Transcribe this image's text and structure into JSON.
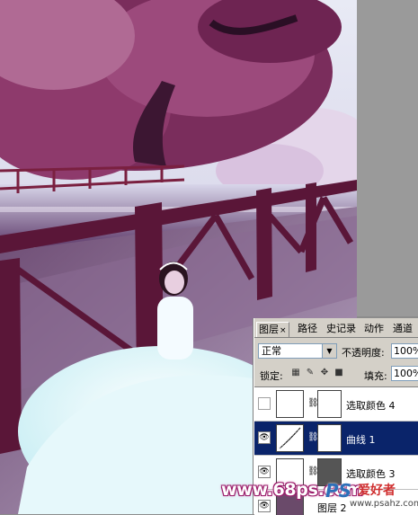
{
  "layers_panel": {
    "tabs": [
      {
        "label": "图层",
        "active": true,
        "close": "×"
      },
      {
        "label": "路径"
      },
      {
        "label": "史记录"
      },
      {
        "label": "动作"
      },
      {
        "label": "通道"
      }
    ],
    "blend_mode": "正常",
    "opacity_label": "不透明度:",
    "opacity_value": "100%",
    "lock_label": "锁定:",
    "fill_label": "填充:",
    "fill_value": "100%",
    "layers": [
      {
        "name": "选取颜色 4",
        "visible": false,
        "selected": false
      },
      {
        "name": "曲线 1",
        "visible": true,
        "selected": true
      },
      {
        "name": "选取颜色 3",
        "visible": true,
        "selected": false
      },
      {
        "name": "图层 2",
        "visible": true,
        "selected": false
      }
    ]
  },
  "watermark": {
    "text": "www.68ps.com"
  },
  "brand": {
    "mark": "PS",
    "name": "爱好者",
    "url": "www.psahz.com"
  },
  "colors": {
    "panel_bg": "#d4d0c8",
    "selection": "#0a246a",
    "watermark_outline": "#9a1c6a"
  }
}
